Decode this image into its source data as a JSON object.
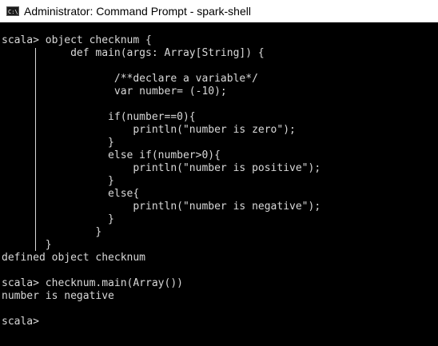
{
  "window": {
    "title": "Administrator: Command Prompt - spark-shell",
    "icon": "cmd-console-icon"
  },
  "console": {
    "lines": [
      "scala> object checknum {",
      "           def main(args: Array[String]) {",
      "",
      "                  /**declare a variable*/",
      "                  var number= (-10);",
      "",
      "                 if(number==0){",
      "                     println(\"number is zero\");",
      "                 }",
      "                 else if(number>0){",
      "                     println(\"number is positive\");",
      "                 }",
      "                 else{",
      "                     println(\"number is negative\");",
      "                 }",
      "               }",
      "       }",
      "defined object checknum",
      "",
      "scala> checknum.main(Array())",
      "number is negative",
      "",
      "scala>"
    ]
  }
}
